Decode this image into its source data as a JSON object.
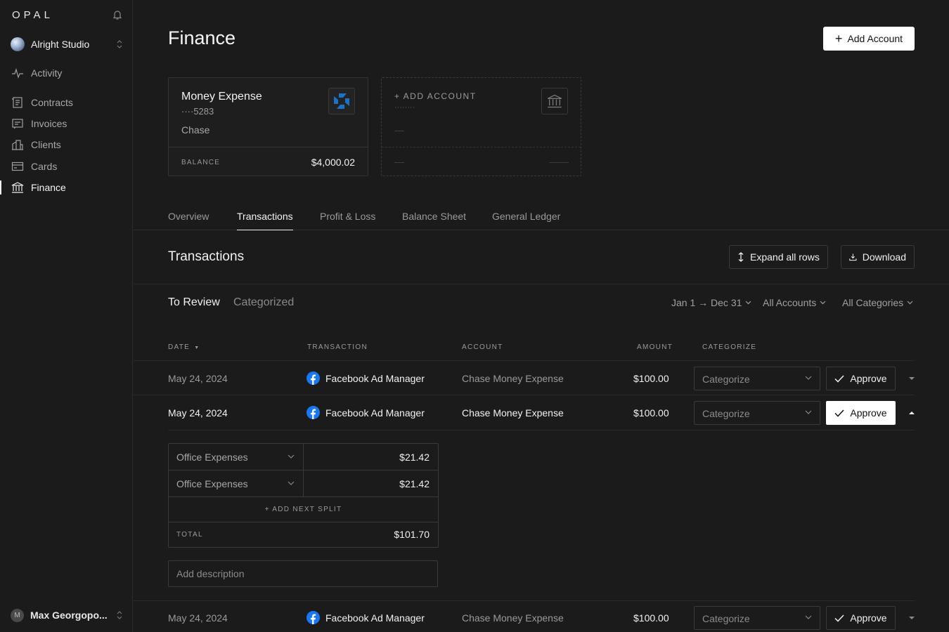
{
  "sidebar": {
    "logo": "OPAL",
    "workspace": "Alright Studio",
    "items": [
      {
        "label": "Activity",
        "icon": "activity-icon"
      },
      {
        "label": "Contracts",
        "icon": "contracts-icon"
      },
      {
        "label": "Invoices",
        "icon": "invoices-icon"
      },
      {
        "label": "Clients",
        "icon": "clients-icon"
      },
      {
        "label": "Cards",
        "icon": "cards-icon"
      },
      {
        "label": "Finance",
        "icon": "bank-icon",
        "active": true
      }
    ],
    "user": {
      "initial": "M",
      "name": "Max Georgopo..."
    }
  },
  "header": {
    "title": "Finance",
    "add_account_label": "Add Account"
  },
  "accounts": {
    "card": {
      "name": "Money Expense",
      "number": "····5283",
      "bank": "Chase",
      "balance_label": "BALANCE",
      "balance": "$4,000.02"
    },
    "placeholder": {
      "label": "+ ADD ACCOUNT",
      "dots": "········",
      "dash1": "—",
      "dash2": "—"
    }
  },
  "tabs": [
    "Overview",
    "Transactions",
    "Profit & Loss",
    "Balance Sheet",
    "General Ledger"
  ],
  "active_tab": "Transactions",
  "transactions": {
    "title": "Transactions",
    "expand_label": "Expand all rows",
    "download_label": "Download",
    "subtabs": [
      "To Review",
      "Categorized"
    ],
    "filters": {
      "date": "Jan 1 → Dec 31",
      "accounts": "All Accounts",
      "categories": "All Categories"
    },
    "columns": {
      "date": "DATE",
      "transaction": "TRANSACTION",
      "account": "ACCOUNT",
      "amount": "AMOUNT",
      "categorize": "CATEGORIZE"
    },
    "rows": [
      {
        "date": "May 24, 2024",
        "transaction": "Facebook Ad Manager",
        "account": "Chase Money Expense",
        "amount": "$100.00",
        "category_placeholder": "Categorize",
        "approve": "Approve",
        "expanded": false
      },
      {
        "date": "May 24, 2024",
        "transaction": "Facebook Ad Manager",
        "account": "Chase Money Expense",
        "amount": "$100.00",
        "category_placeholder": "Categorize",
        "approve": "Approve",
        "expanded": true
      },
      {
        "date": "May 24, 2024",
        "transaction": "Facebook Ad Manager",
        "account": "Chase Money Expense",
        "amount": "$100.00",
        "category_placeholder": "Categorize",
        "approve": "Approve",
        "expanded": false
      }
    ],
    "split": {
      "lines": [
        {
          "category": "Office Expenses",
          "amount": "$21.42"
        },
        {
          "category": "Office Expenses",
          "amount": "$21.42"
        }
      ],
      "add_label": "+ ADD NEXT SPLIT",
      "total_label": "TOTAL",
      "total": "$101.70",
      "description_placeholder": "Add description"
    }
  },
  "colors": {
    "background": "#1b1b1b",
    "chase_blue": "#1a73c9",
    "facebook_blue": "#1877f2"
  }
}
